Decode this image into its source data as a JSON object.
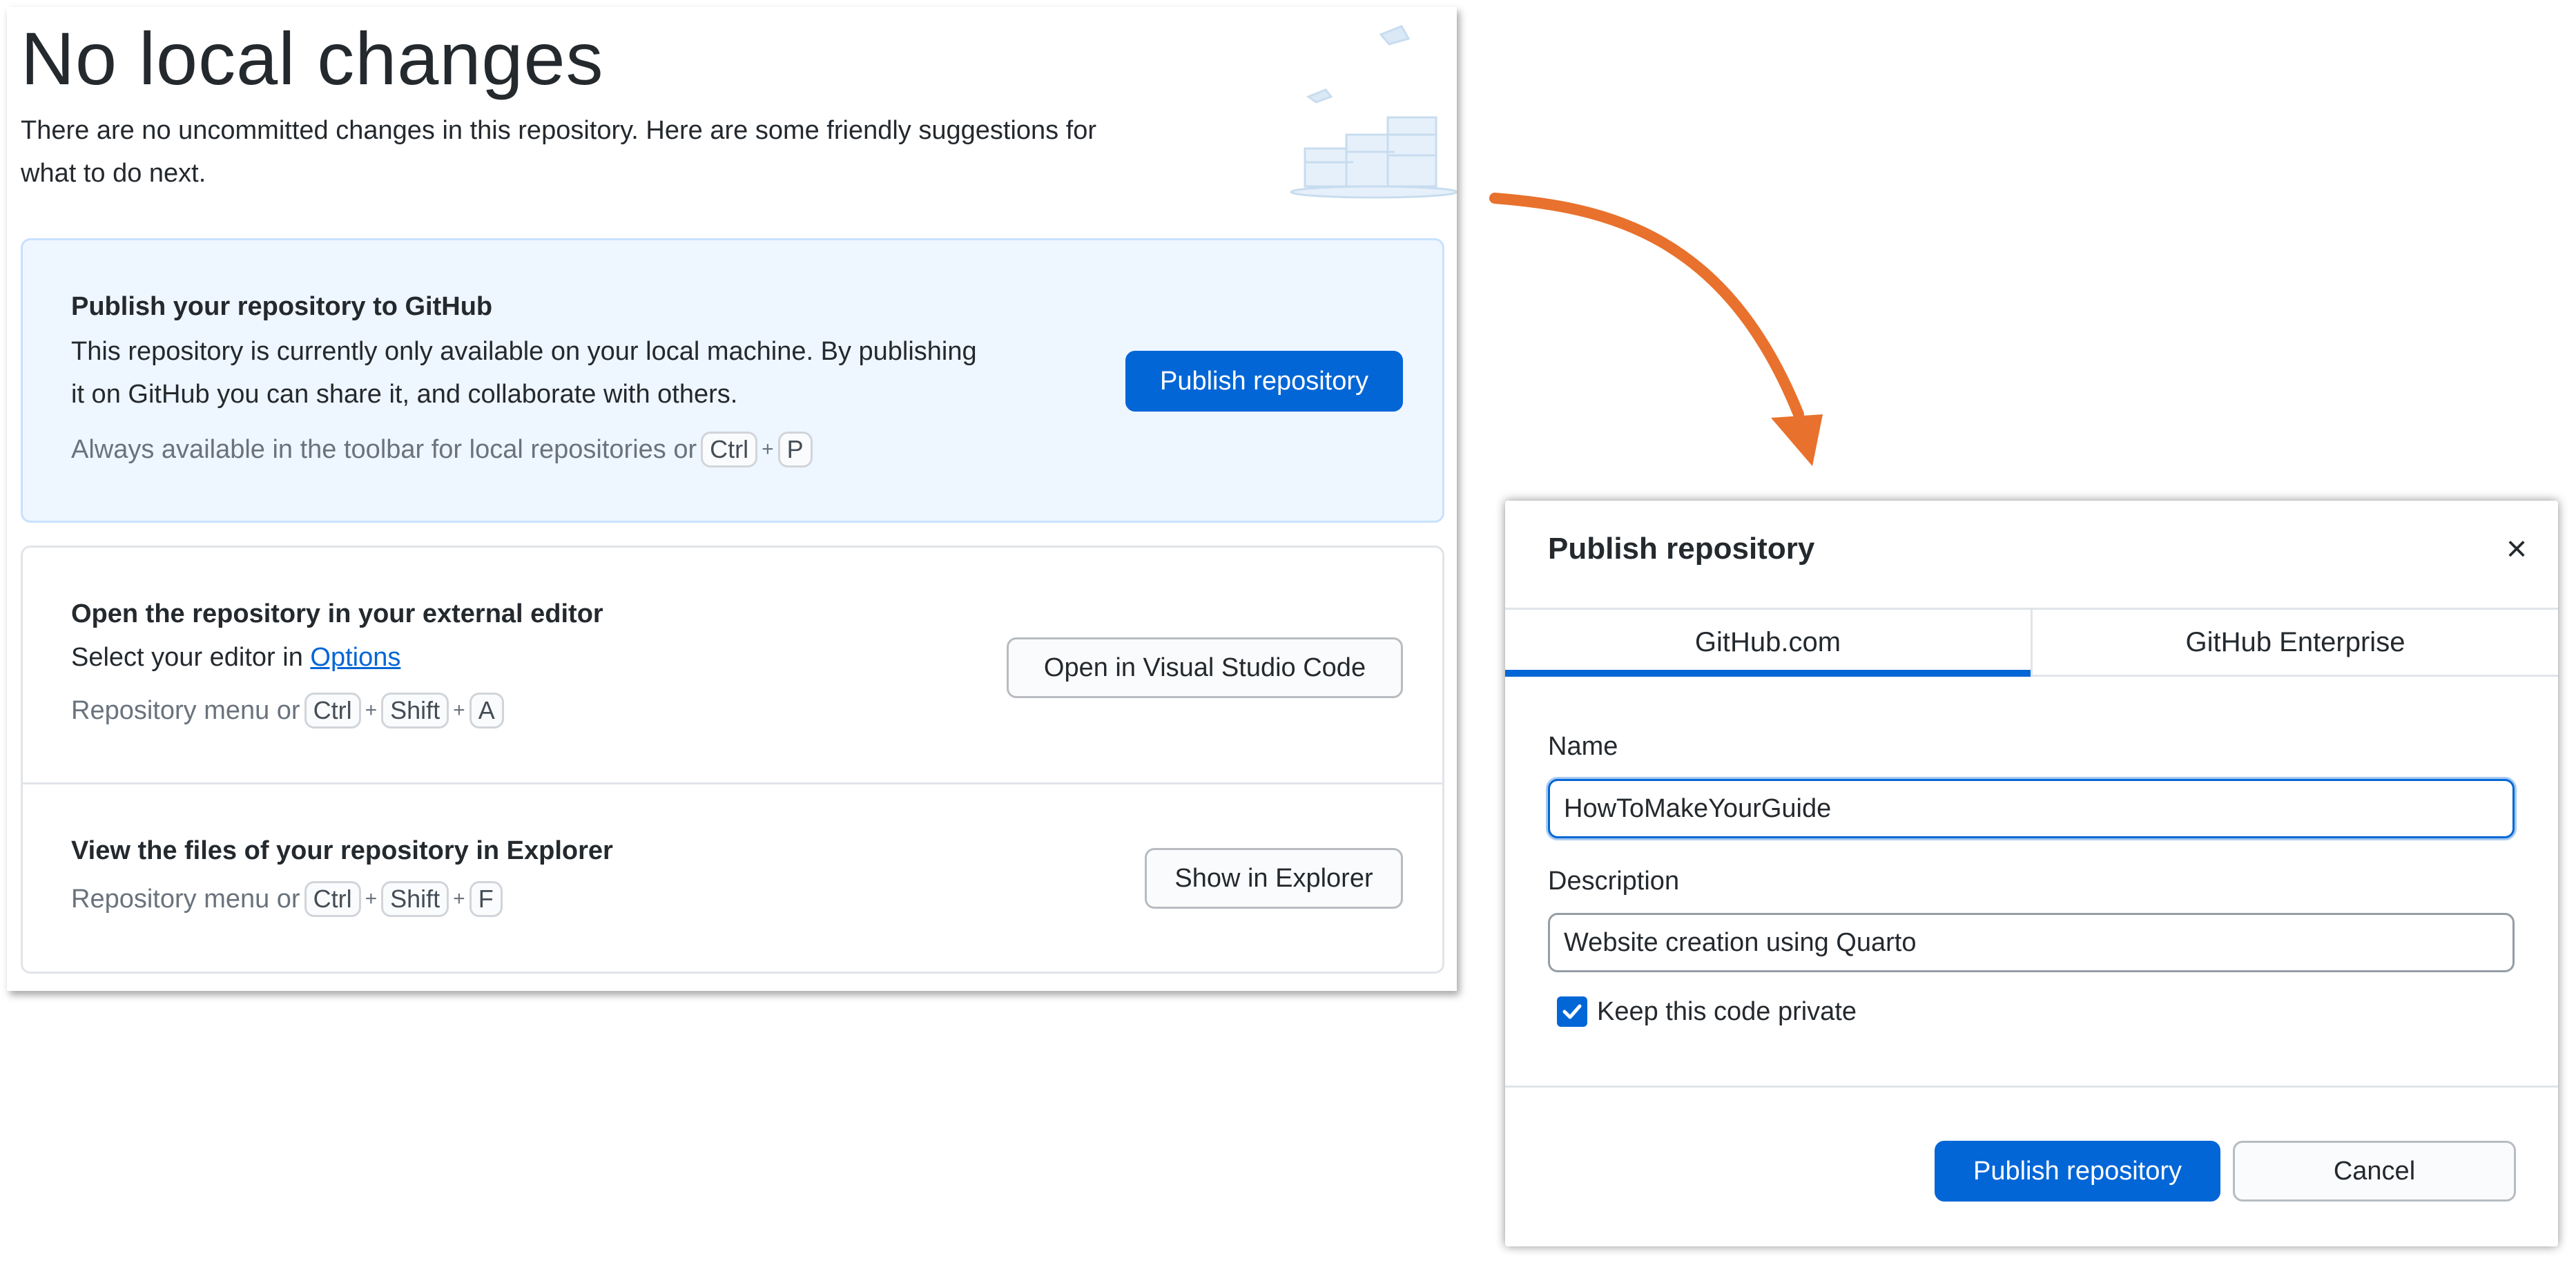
{
  "left": {
    "title": "No local changes",
    "intro_line1": "There are no uncommitted changes in this repository. Here are some friendly suggestions for",
    "intro_line2": "what to do next.",
    "publish": {
      "title": "Publish your repository to GitHub",
      "line1": "This repository is currently only available on your local machine. By publishing",
      "line2": "it on GitHub you can share it, and collaborate with others.",
      "hint_prefix": "Always available in the toolbar for local repositories or",
      "keys": [
        "Ctrl",
        "P"
      ],
      "button": "Publish repository"
    },
    "editor": {
      "title": "Open the repository in your external editor",
      "line_prefix": "Select your editor in",
      "link": "Options",
      "hint_prefix": "Repository menu or",
      "keys": [
        "Ctrl",
        "Shift",
        "A"
      ],
      "button": "Open in Visual Studio Code"
    },
    "explorer": {
      "title": "View the files of your repository in Explorer",
      "hint_prefix": "Repository menu or",
      "keys": [
        "Ctrl",
        "Shift",
        "F"
      ],
      "button": "Show in Explorer"
    },
    "plus": "+"
  },
  "dialog": {
    "title": "Publish repository",
    "close": "×",
    "tabs": [
      "GitHub.com",
      "GitHub Enterprise"
    ],
    "active_tab": "GitHub.com",
    "name_label": "Name",
    "name_value": "HowToMakeYourGuide",
    "description_label": "Description",
    "description_value": "Website creation using Quarto",
    "private_label": "Keep this code private",
    "private_checked": true,
    "publish_button": "Publish repository",
    "cancel_button": "Cancel"
  },
  "colors": {
    "accent": "#0366d6",
    "arrow": "#e8712d",
    "highlight_bg": "#eef6ff"
  }
}
